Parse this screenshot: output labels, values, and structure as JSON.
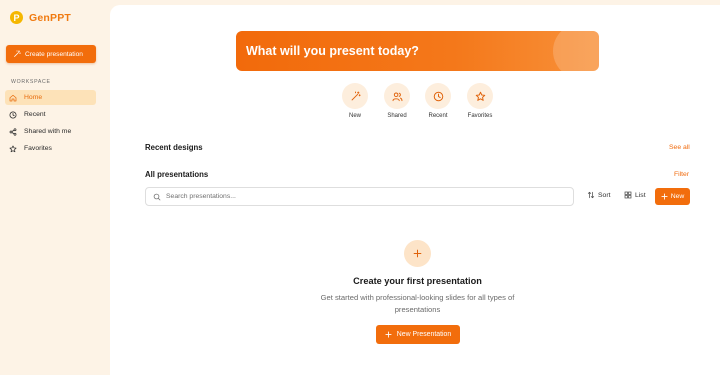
{
  "brand": {
    "logo_letter": "P",
    "name": "GenPPT"
  },
  "sidebar": {
    "create_label": "Create presentation",
    "section_label": "WORKSPACE",
    "items": [
      {
        "label": "Home",
        "icon": "home-icon",
        "active": true
      },
      {
        "label": "Recent",
        "icon": "clock-icon",
        "active": false
      },
      {
        "label": "Shared with me",
        "icon": "share-icon",
        "active": false
      },
      {
        "label": "Favorites",
        "icon": "star-icon",
        "active": false
      }
    ]
  },
  "hero": {
    "title": "What will you present today?"
  },
  "quick_actions": [
    {
      "label": "New",
      "icon": "magic-wand-icon"
    },
    {
      "label": "Shared",
      "icon": "users-icon"
    },
    {
      "label": "Recent",
      "icon": "clock-icon"
    },
    {
      "label": "Favorites",
      "icon": "star-icon"
    }
  ],
  "recent": {
    "title": "Recent designs",
    "link": "See all"
  },
  "all": {
    "title": "All presentations",
    "link": "Filter"
  },
  "search": {
    "placeholder": "Search presentations...",
    "value": ""
  },
  "toolbar": {
    "sort_label": "Sort",
    "list_label": "List",
    "new_label": "New"
  },
  "empty_state": {
    "title": "Create your first presentation",
    "description": "Get started with professional-looking slides for all types of presentations",
    "button_label": "New Presentation"
  },
  "colors": {
    "accent": "#f26d0c",
    "sidebar_bg": "#fdf3e6",
    "active_bg": "#fde2b8",
    "brand": "#f07a10"
  }
}
